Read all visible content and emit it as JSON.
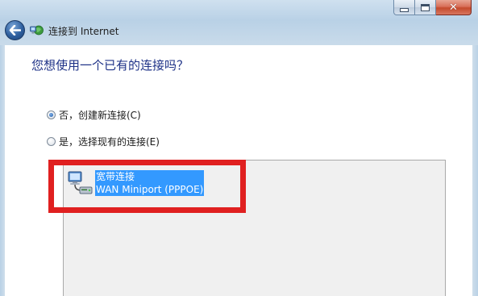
{
  "window": {
    "title": "连接到 Internet",
    "close_symbol": "✕"
  },
  "question": "您想使用一个已有的连接吗？",
  "options": [
    {
      "label": "否，创建新连接(C)",
      "selected": true
    },
    {
      "label": "是，选择现有的连接(E)",
      "selected": false
    }
  ],
  "connections": [
    {
      "name": "宽带连接",
      "device": "WAN Miniport (PPPOE)",
      "selected": true
    }
  ],
  "colors": {
    "accent": "#1e3287",
    "selection": "#3399ff",
    "highlight": "#e02020"
  },
  "icons": {
    "back": "back-arrow-icon",
    "app": "network-globe-icon",
    "connection": "network-computer-icon"
  }
}
